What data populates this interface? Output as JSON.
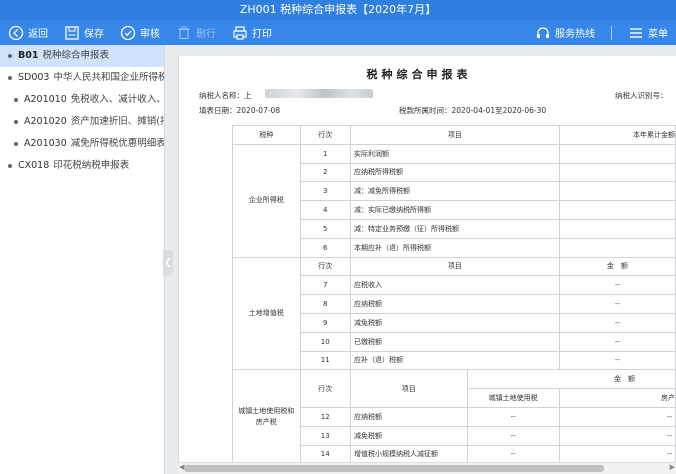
{
  "window": {
    "title": "ZH001 税种综合申报表【2020年7月】"
  },
  "toolbar": {
    "back": "返回",
    "save": "保存",
    "review": "审核",
    "delete": "删行",
    "print": "打印",
    "hotline": "服务热线",
    "menu": "菜单"
  },
  "sidebar": {
    "items": [
      {
        "code": "B01",
        "name": "税种综合申报表",
        "level": 0,
        "active": true
      },
      {
        "code": "SD003",
        "name": "中华人民共和国企业所得税",
        "level": 0,
        "active": false
      },
      {
        "code": "A201010",
        "name": "免税收入、减计收入、",
        "level": 1,
        "active": false
      },
      {
        "code": "A201020",
        "name": "资产加速折旧、摊销(扣",
        "level": 1,
        "active": false
      },
      {
        "code": "A201030",
        "name": "减免所得税优惠明细表",
        "level": 1,
        "active": false
      },
      {
        "code": "CX018",
        "name": "印花税纳税申报表",
        "level": 0,
        "active": false
      }
    ]
  },
  "doc": {
    "title": "税种综合申报表",
    "taxpayer_name_label": "纳税人名称：",
    "taxpayer_name_prefix": "上",
    "taxpayer_id_label": "纳税人识别号：",
    "fill_date": "填表日期：2020-07-08",
    "period": "税款所属时间：2020-04-01至2020-06-30"
  },
  "table": {
    "header": {
      "tax": "税种",
      "row": "行次",
      "item": "项目",
      "ytd": "本年累计金额"
    },
    "cit": {
      "group": "企业所得税",
      "rows": [
        {
          "no": "1",
          "item": "实际利润额"
        },
        {
          "no": "2",
          "item": "应纳税所得税额"
        },
        {
          "no": "3",
          "item": "减：减免所得税额"
        },
        {
          "no": "4",
          "item": "减：实际已缴纳税所得额"
        },
        {
          "no": "5",
          "item": "减：特定业务预缴（征）所得税额"
        },
        {
          "no": "6",
          "item": "本期应补（退）所得税额"
        }
      ]
    },
    "lvat": {
      "group": "土地增值税",
      "header": {
        "row": "行次",
        "item": "项目",
        "amount": "金　额"
      },
      "rows": [
        {
          "no": "7",
          "item": "应税收入",
          "amount": "--"
        },
        {
          "no": "8",
          "item": "应纳税额",
          "amount": "--"
        },
        {
          "no": "9",
          "item": "减免税额",
          "amount": "--"
        },
        {
          "no": "10",
          "item": "已缴税额",
          "amount": "--"
        },
        {
          "no": "11",
          "item": "应补（退）税额",
          "amount": "--"
        }
      ]
    },
    "urban": {
      "group": "城镇土地使用税和房产税",
      "header": {
        "row": "行次",
        "item": "项目",
        "amount": "金　额",
        "land": "城镇土地使用税",
        "property": "房产"
      },
      "rows": [
        {
          "no": "12",
          "item": "应纳税额",
          "land": "--",
          "property": "--"
        },
        {
          "no": "13",
          "item": "减免税额",
          "land": "--",
          "property": "--"
        },
        {
          "no": "14",
          "item": "增值税小规模纳税人减征额",
          "land": "--",
          "property": "--"
        }
      ]
    }
  },
  "colors": {
    "titlebar": "#2f7fe0",
    "toolbar": "#3787e8",
    "sidebar_active": "#cfe3fa"
  }
}
